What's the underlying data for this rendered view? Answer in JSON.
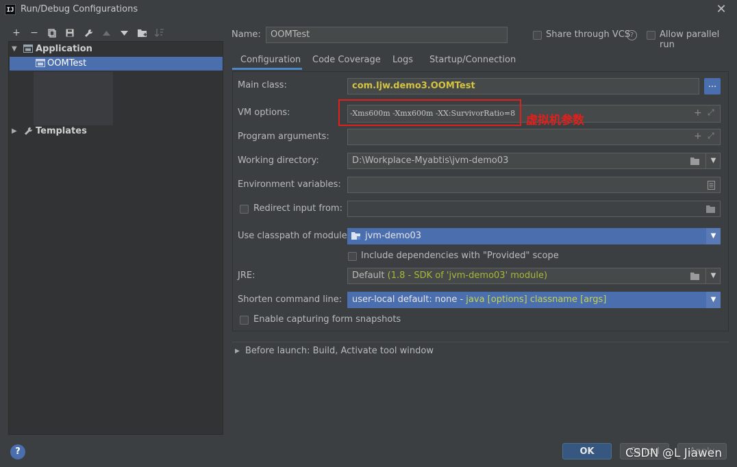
{
  "window": {
    "title": "Run/Debug Configurations",
    "app_icon": "IJ"
  },
  "toolbar": {
    "add": "+",
    "remove": "−",
    "copy": "⧉",
    "save": "💾",
    "edit_defaults": "🔧",
    "move_up": "▲",
    "move_down": "▼",
    "new_folder": "📁",
    "sort": "↓"
  },
  "tree": {
    "group_label": "Application",
    "config_label": "OOMTest",
    "templates_label": "Templates"
  },
  "header": {
    "name_label": "Name:",
    "name_value": "OOMTest",
    "share_vcs_label": "Share through VCS",
    "help_icon": "?",
    "allow_parallel_label": "Allow parallel run"
  },
  "tabs": [
    "Configuration",
    "Code Coverage",
    "Logs",
    "Startup/Connection"
  ],
  "form": {
    "main_class_label": "Main class:",
    "main_class_value": "com.ljw.demo3.OOMTest",
    "browse_button": "...",
    "vm_options_label": "VM options:",
    "vm_options_value": "-Xms600m -Xmx600m -XX:SurvivorRatio=8",
    "vm_annotation": "虚拟机参数",
    "program_args_label": "Program arguments:",
    "program_args_value": "",
    "working_dir_label": "Working directory:",
    "working_dir_value": "D:\\Workplace-Myabtis\\jvm-demo03",
    "env_vars_label": "Environment variables:",
    "env_vars_value": "",
    "redirect_input_label": "Redirect input from:",
    "classpath_label": "Use classpath of module:",
    "classpath_value": "jvm-demo03",
    "include_provided_label": "Include dependencies with \"Provided\" scope",
    "jre_label": "JRE:",
    "jre_default": "Default",
    "jre_detail": "(1.8 - SDK of 'jvm-demo03' module)",
    "shorten_label": "Shorten command line:",
    "shorten_value_main": "user-local default: none",
    "shorten_value_sep": " - ",
    "shorten_value_detail": "java [options] classname [args]",
    "capture_snapshots_label": "Enable capturing form snapshots"
  },
  "before_launch": {
    "label": "Before launch: Build, Activate tool window"
  },
  "footer": {
    "help_icon": "?",
    "ok_label": "OK",
    "cancel_label": "Cancel",
    "apply_label": "Apply",
    "watermark": "CSDN @L Jiawen"
  },
  "colors": {
    "background": "#3c3f41",
    "selection": "#4b6eaf",
    "annotation_red": "#e0201c",
    "green_text": "#a9b837"
  }
}
